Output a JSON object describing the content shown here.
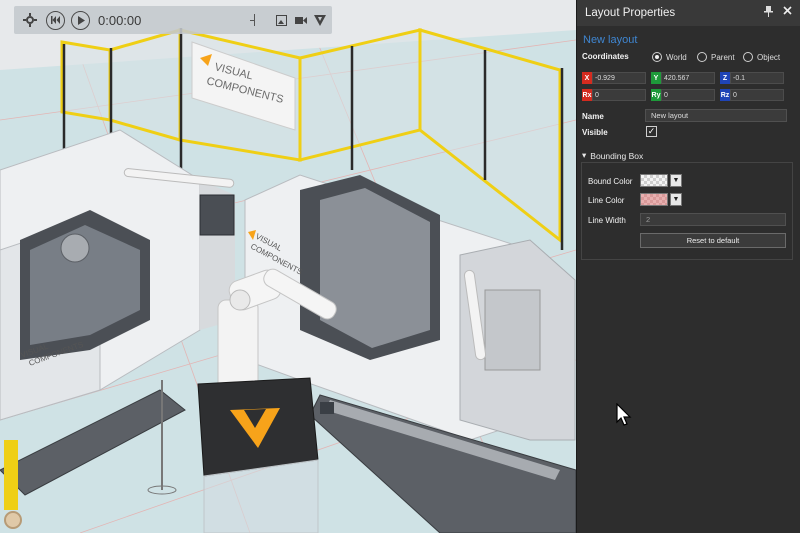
{
  "playbar": {
    "settings_icon": "gear-icon",
    "rewind_icon": "skip-back-icon",
    "play_icon": "play-icon",
    "time": "0:00:00",
    "screenshot_icon": "image-icon",
    "record_icon": "video-camera-icon",
    "vc_icon": "vc-logo-icon"
  },
  "scene": {
    "brand_sign_line1": "VISUAL",
    "brand_sign_line2": "COMPONENTS",
    "machine_left_line1": "VISUAL",
    "machine_left_line2": "COMPONENTS",
    "machine_right_line1": "VISUAL",
    "machine_right_line2": "COMPONENTS",
    "colors": {
      "floor": "#cfe3e6",
      "fence": "#f0d21c",
      "machine": "#eef0f2",
      "accent": "#f7a31a"
    }
  },
  "panel": {
    "title": "Layout Properties",
    "pin_icon": "pin-icon",
    "close_icon": "close-icon",
    "object_name": "New layout",
    "coordinates_label": "Coordinates",
    "coord_modes": [
      {
        "label": "World",
        "selected": true
      },
      {
        "label": "Parent",
        "selected": false
      },
      {
        "label": "Object",
        "selected": false
      }
    ],
    "position": {
      "x_label": "X",
      "x": "-0.929",
      "y_label": "Y",
      "y": "420.567",
      "z_label": "Z",
      "z": "-0.1"
    },
    "rotation": {
      "rx_label": "Rx",
      "rx": "0",
      "ry_label": "Ry",
      "ry": "0",
      "rz_label": "Rz",
      "rz": "0"
    },
    "name_label": "Name",
    "name_value": "New layout",
    "visible_label": "Visible",
    "visible_checked": true,
    "bounding_box": {
      "title": "Bounding Box",
      "bound_color_label": "Bound Color",
      "line_color_label": "Line Color",
      "line_width_label": "Line Width",
      "line_width_value": "2",
      "reset_button": "Reset to default"
    }
  }
}
